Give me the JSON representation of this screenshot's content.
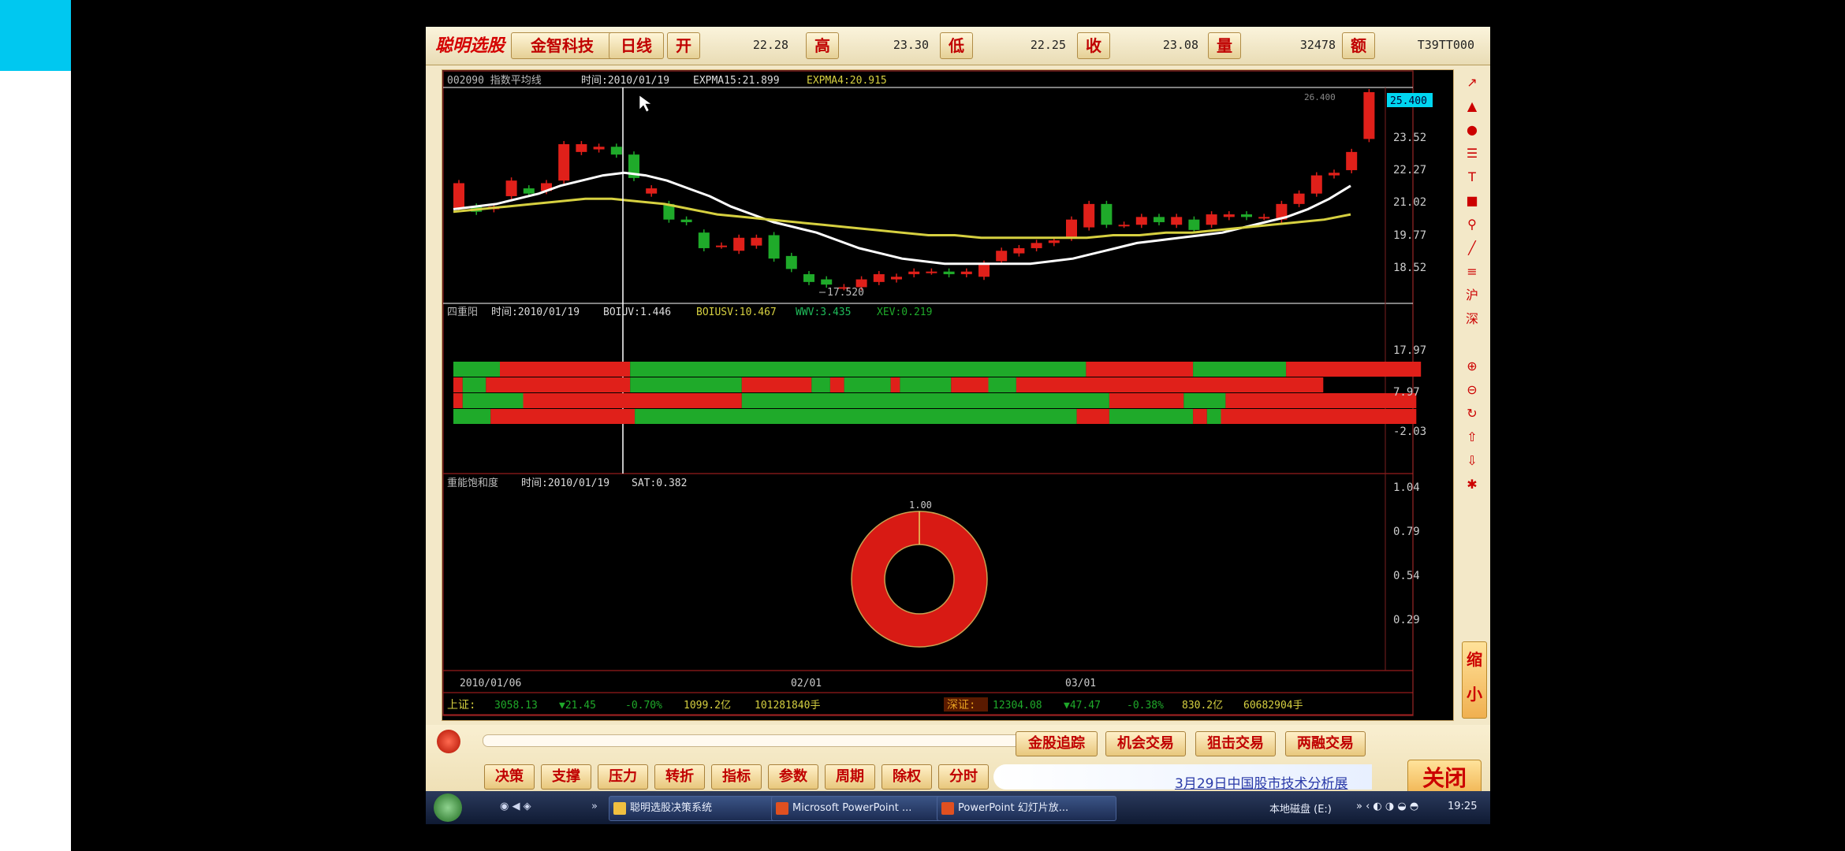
{
  "colors": {
    "up": "#e0201a",
    "down": "#1faa2a",
    "white_line": "#ffffff",
    "yellow_line": "#d6d040",
    "panel_bg": "#000000",
    "accent": "#c00000"
  },
  "topbar": {
    "logo": "聪明选股",
    "company": "金智科技",
    "period": "日线",
    "open_label": "开",
    "open_value": "22.28",
    "high_label": "高",
    "high_value": "23.30",
    "low_label": "低",
    "low_value": "22.25",
    "close_label": "收",
    "close_value": "23.08",
    "volume_label": "量",
    "volume_value": "32478",
    "amount_label": "额",
    "amount_value": "T39TT000"
  },
  "panel1": {
    "title": "002090 指数平均线",
    "time": "时间:2010/01/19",
    "ind1": "EXPMA15:21.899",
    "ind2": "EXPMA4:20.915",
    "y_ticks": [
      "23.52",
      "22.27",
      "21.02",
      "19.77",
      "18.52"
    ],
    "high_label": "26.400",
    "low_label": "17.520",
    "current_price": "25.400"
  },
  "panel2": {
    "title": "四重阳",
    "time": "时间:2010/01/19",
    "ind1": "BOIUV:1.446",
    "ind2": "BOIUSV:10.467",
    "ind3": "WWV:3.435",
    "ind4": "XEV:0.219",
    "y_ticks": [
      "17.97",
      "7.97",
      "-2.03"
    ]
  },
  "panel3": {
    "title": "重能饱和度",
    "time": "时间:2010/01/19",
    "ind1": "SAT:0.382",
    "y_ticks": [
      "1.04",
      "0.79",
      "0.54",
      "0.29"
    ],
    "ring_label": "1.00",
    "sat_value": 1.0
  },
  "x_labels": [
    "2010/01/06",
    "02/01",
    "03/01"
  ],
  "status": {
    "sh_label": "上证:",
    "sh_index": "3058.13",
    "sh_change": "▼21.45",
    "sh_pct": "-0.70%",
    "sh_amount": "1099.2亿",
    "sh_volume": "101281840手",
    "sz_label": "深证:",
    "sz_index": "12304.08",
    "sz_change": "▼47.47",
    "sz_pct": "-0.38%",
    "sz_amount": "830.2亿",
    "sz_volume": "60682904手"
  },
  "chart_data": {
    "type": "candlestick",
    "x_labels": [
      "2010/01/06",
      "02/01",
      "03/01"
    ],
    "candles": [
      {
        "o": 20.9,
        "c": 21.9
      },
      {
        "o": 21.0,
        "c": 20.8
      },
      {
        "o": 20.9,
        "c": 21.0
      },
      {
        "o": 21.4,
        "c": 22.0
      },
      {
        "o": 21.7,
        "c": 21.5
      },
      {
        "o": 21.6,
        "c": 21.9
      },
      {
        "o": 22.0,
        "c": 23.4
      },
      {
        "o": 23.1,
        "c": 23.4
      },
      {
        "o": 23.2,
        "c": 23.3
      },
      {
        "o": 23.3,
        "c": 23.0
      },
      {
        "o": 23.0,
        "c": 22.1
      },
      {
        "o": 21.5,
        "c": 21.7
      },
      {
        "o": 21.1,
        "c": 20.5
      },
      {
        "o": 20.5,
        "c": 20.4
      },
      {
        "o": 20.0,
        "c": 19.4
      },
      {
        "o": 19.5,
        "c": 19.5
      },
      {
        "o": 19.3,
        "c": 19.8
      },
      {
        "o": 19.5,
        "c": 19.8
      },
      {
        "o": 19.9,
        "c": 19.0
      },
      {
        "o": 19.1,
        "c": 18.6
      },
      {
        "o": 18.4,
        "c": 18.1
      },
      {
        "o": 18.2,
        "c": 18.0
      },
      {
        "o": 17.9,
        "c": 17.9
      },
      {
        "o": 17.9,
        "c": 18.2
      },
      {
        "o": 18.1,
        "c": 18.4
      },
      {
        "o": 18.2,
        "c": 18.3
      },
      {
        "o": 18.4,
        "c": 18.5
      },
      {
        "o": 18.5,
        "c": 18.5
      },
      {
        "o": 18.5,
        "c": 18.4
      },
      {
        "o": 18.4,
        "c": 18.5
      },
      {
        "o": 18.3,
        "c": 18.8
      },
      {
        "o": 18.9,
        "c": 19.3
      },
      {
        "o": 19.2,
        "c": 19.4
      },
      {
        "o": 19.4,
        "c": 19.6
      },
      {
        "o": 19.6,
        "c": 19.7
      },
      {
        "o": 19.8,
        "c": 20.5
      },
      {
        "o": 20.2,
        "c": 21.1
      },
      {
        "o": 21.1,
        "c": 20.3
      },
      {
        "o": 20.3,
        "c": 20.3
      },
      {
        "o": 20.3,
        "c": 20.6
      },
      {
        "o": 20.6,
        "c": 20.4
      },
      {
        "o": 20.3,
        "c": 20.6
      },
      {
        "o": 20.5,
        "c": 20.1
      },
      {
        "o": 20.3,
        "c": 20.7
      },
      {
        "o": 20.6,
        "c": 20.7
      },
      {
        "o": 20.7,
        "c": 20.6
      },
      {
        "o": 20.6,
        "c": 20.6
      },
      {
        "o": 20.5,
        "c": 21.1
      },
      {
        "o": 21.1,
        "c": 21.5
      },
      {
        "o": 21.5,
        "c": 22.2
      },
      {
        "o": 22.2,
        "c": 22.3
      },
      {
        "o": 22.4,
        "c": 23.1
      },
      {
        "o": 23.6,
        "c": 25.4
      }
    ],
    "expma_fast": [
      20.9,
      21.0,
      21.1,
      21.3,
      21.5,
      21.8,
      22.0,
      22.2,
      22.3,
      22.2,
      22.0,
      21.7,
      21.4,
      21.0,
      20.7,
      20.4,
      20.2,
      20.0,
      19.7,
      19.4,
      19.2,
      19.0,
      18.9,
      18.8,
      18.8,
      18.8,
      18.8,
      18.8,
      18.9,
      19.0,
      19.2,
      19.4,
      19.6,
      19.7,
      19.8,
      19.9,
      20.0,
      20.2,
      20.4,
      20.6,
      20.9,
      21.3,
      21.8
    ],
    "expma_slow": [
      20.8,
      20.9,
      21.0,
      21.1,
      21.2,
      21.3,
      21.3,
      21.2,
      21.1,
      20.9,
      20.7,
      20.6,
      20.5,
      20.4,
      20.3,
      20.2,
      20.1,
      20.0,
      19.9,
      19.9,
      19.8,
      19.8,
      19.8,
      19.8,
      19.8,
      19.9,
      19.9,
      20.0,
      20.0,
      20.1,
      20.2,
      20.3,
      20.4,
      20.5,
      20.7
    ]
  }
}
